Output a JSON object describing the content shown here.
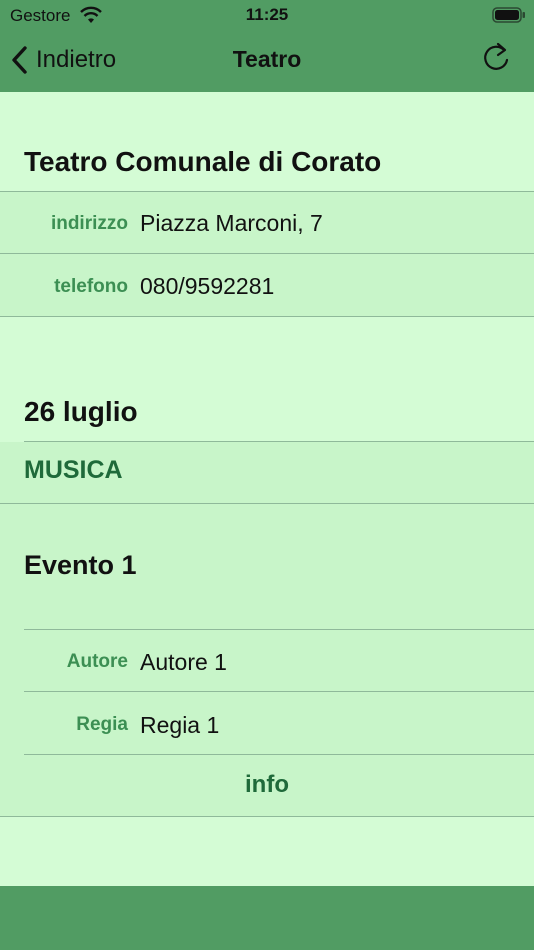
{
  "status_bar": {
    "carrier": "Gestore",
    "time": "11:25"
  },
  "nav": {
    "back_label": "Indietro",
    "title": "Teatro",
    "refresh_icon": "refresh-icon"
  },
  "venue": {
    "name": "Teatro Comunale di Corato",
    "fields": [
      {
        "key": "indirizzo",
        "value": "Piazza Marconi, 7"
      },
      {
        "key": "telefono",
        "value": "080/9592281"
      }
    ]
  },
  "schedule": {
    "date": "26 luglio",
    "category": "MUSICA",
    "event": {
      "title": "Evento 1",
      "fields": [
        {
          "key": "Autore",
          "value": "Autore 1"
        },
        {
          "key": "Regia",
          "value": "Regia 1"
        }
      ],
      "info_label": "info"
    }
  },
  "colors": {
    "bar": "#519c63",
    "background": "#d4fcd5",
    "band": "#c8f5c9",
    "label_green": "#3c8f53",
    "accent_green": "#1f6a3a"
  }
}
